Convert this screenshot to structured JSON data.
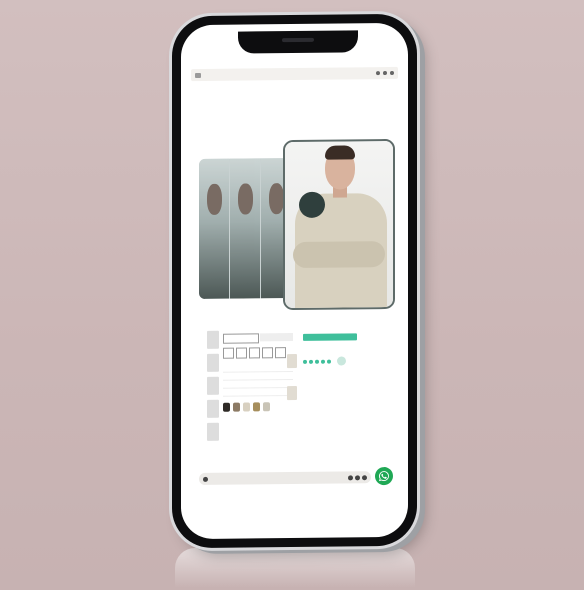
{
  "nav": {
    "items": [
      "",
      "",
      "",
      ""
    ]
  },
  "product": {
    "name": "",
    "tabs": [
      "",
      ""
    ],
    "sizes": [
      "",
      "",
      "",
      "",
      ""
    ],
    "rows": [
      {
        "label": "",
        "v1": "",
        "v2": ""
      },
      {
        "label": "",
        "v1": "",
        "v2": ""
      },
      {
        "label": "",
        "v1": "",
        "v2": ""
      },
      {
        "label": "",
        "v1": "",
        "v2": ""
      }
    ],
    "swatch_colors": [
      "#2e2a26",
      "#8c7a64",
      "#d8d0c0",
      "#a68e5c",
      "#c9c4b6"
    ]
  },
  "side_panel": {
    "cta_label": "",
    "headline": "",
    "caption": "",
    "rating_stars": 5
  },
  "search": {
    "placeholder": ""
  },
  "colors": {
    "background": "#cdb9b9",
    "accent": "#3fbf9b",
    "whatsapp": "#1fa855",
    "frame": "#0d0d0f"
  }
}
